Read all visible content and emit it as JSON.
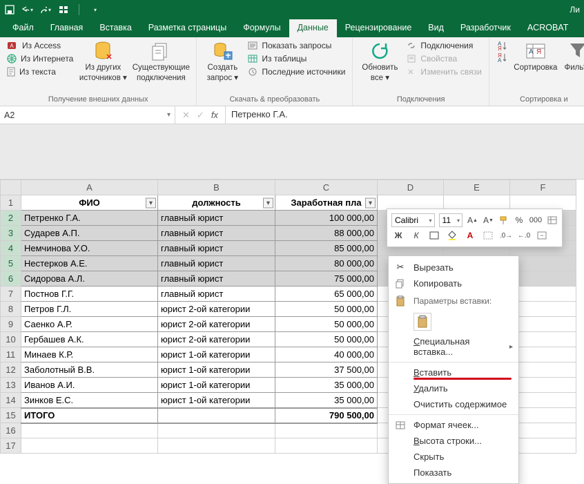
{
  "titlebar": {
    "right_text": "Ли"
  },
  "tabs": {
    "file": "Файл",
    "home": "Главная",
    "insert": "Вставка",
    "pagelayout": "Разметка страницы",
    "formulas": "Формулы",
    "data": "Данные",
    "review": "Рецензирование",
    "view": "Вид",
    "developer": "Разработчик",
    "acrobat": "ACROBAT"
  },
  "ribbon": {
    "group_getdata": {
      "label": "Получение внешних данных",
      "from_access": "Из Access",
      "from_web": "Из Интернета",
      "from_text": "Из текста",
      "other_sources_1": "Из других",
      "other_sources_2": "источников",
      "existing_conn_1": "Существующие",
      "existing_conn_2": "подключения"
    },
    "group_getxform": {
      "label": "Скачать & преобразовать",
      "newquery_1": "Создать",
      "newquery_2": "запрос",
      "show_queries": "Показать запросы",
      "from_table": "Из таблицы",
      "recent_sources": "Последние источники"
    },
    "group_connections": {
      "label": "Подключения",
      "refresh_1": "Обновить",
      "refresh_2": "все",
      "connections": "Подключения",
      "properties": "Свойства",
      "edit_links": "Изменить связи"
    },
    "group_sort": {
      "label": "Сортировка и ",
      "sort": "Сортировка",
      "filter": "Фильтр"
    }
  },
  "namebox": "A2",
  "formula": "Петренко Г.А.",
  "chart_data": {
    "type": "table",
    "columns": [
      "ФИО",
      "должность",
      "Заработная пла"
    ],
    "rows": [
      [
        "Петренко Г.А.",
        "главный юрист",
        "100 000,00"
      ],
      [
        "Сударев А.П.",
        "главный юрист",
        "88 000,00"
      ],
      [
        "Немчинова У.О.",
        "главный юрист",
        "85 000,00"
      ],
      [
        "Нестерков А.Е.",
        "главный юрист",
        "80 000,00"
      ],
      [
        "Сидорова А.Л.",
        "главный юрист",
        "75 000,00"
      ],
      [
        "Постнов Г.Г.",
        "главный юрист",
        "65 000,00"
      ],
      [
        "Петров Г.Л.",
        "юрист 2-ой категории",
        "50 000,00"
      ],
      [
        "Саенко А.Р.",
        "юрист 2-ой категории",
        "50 000,00"
      ],
      [
        "Гербашев А.К.",
        "юрист 2-ой категории",
        "50 000,00"
      ],
      [
        "Минаев К.Р.",
        "юрист 1-ой категории",
        "40 000,00"
      ],
      [
        "Заболотный В.В.",
        "юрист 1-ой категории",
        "37 500,00"
      ],
      [
        "Иванов А.И.",
        "юрист 1-ой категории",
        "35 000,00"
      ],
      [
        "Зинков Е.С.",
        "юрист 1-ой категории",
        "35 000,00"
      ]
    ],
    "total_label": "ИТОГО",
    "total_value": "790 500,00",
    "col_letters": [
      "A",
      "B",
      "C",
      "D",
      "E",
      "F"
    ],
    "selected_rows": [
      2,
      3,
      4,
      5,
      6
    ]
  },
  "minitoolbar": {
    "font": "Calibri",
    "size": "11",
    "bold": "Ж",
    "italic": "К"
  },
  "ctx": {
    "cut": "Вырезать",
    "copy": "Копировать",
    "paste_heading": "Параметры вставки:",
    "paste_special": "Специальная вставка...",
    "insert": "Вставить",
    "delete": "Удалить",
    "clear": "Очистить содержимое",
    "formatcells": "Формат ячеек...",
    "rowheight": "Высота строки...",
    "hide": "Скрыть",
    "show": "Показать"
  }
}
